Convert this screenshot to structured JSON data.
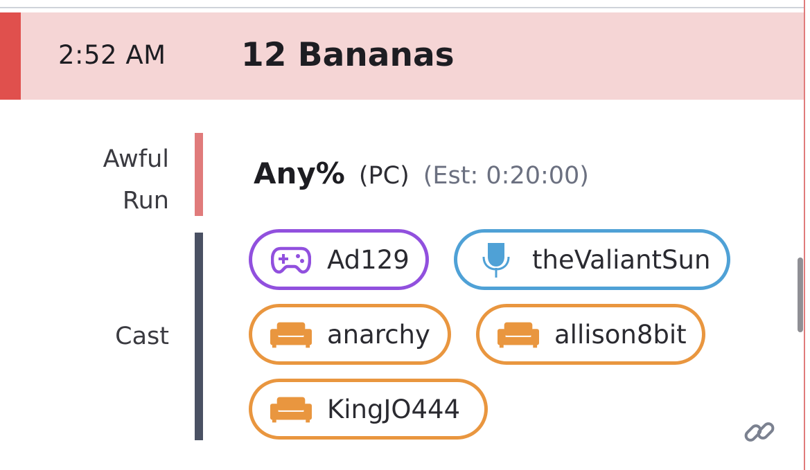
{
  "header": {
    "time": "2:52 AM",
    "title": "12 Bananas"
  },
  "run": {
    "label_line1": "Awful",
    "label_line2": "Run",
    "category": "Any%",
    "platform": "(PC)",
    "estimate": "(Est: 0:20:00)"
  },
  "cast": {
    "label": "Cast",
    "members": [
      {
        "name": "Ad129",
        "role": "runner",
        "icon": "gamepad-icon",
        "color": "#9150de"
      },
      {
        "name": "theValiantSun",
        "role": "commentator",
        "icon": "microphone-icon",
        "color": "#4fa1d6"
      },
      {
        "name": "anarchy",
        "role": "couch",
        "icon": "couch-icon",
        "color": "#e9963f"
      },
      {
        "name": "allison8bit",
        "role": "couch",
        "icon": "couch-icon",
        "color": "#e9963f"
      },
      {
        "name": "KingJO444",
        "role": "couch",
        "icon": "couch-icon",
        "color": "#e9963f"
      }
    ]
  },
  "colors": {
    "header_background": "#f5d5d5",
    "header_accent": "#e0504d",
    "run_bar": "#e07b7b",
    "cast_bar": "#4a5163"
  },
  "actions": {
    "link_icon": "link-icon"
  }
}
